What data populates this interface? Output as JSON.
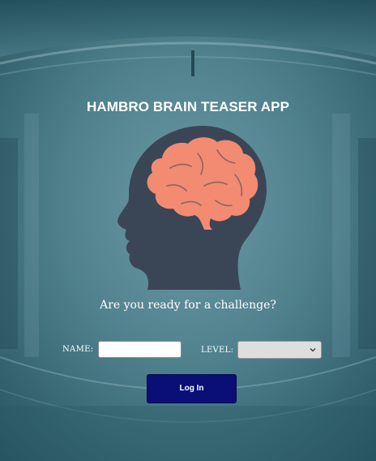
{
  "app": {
    "title": "HAMBRO BRAIN TEASER APP",
    "tagline": "Are you ready for a challenge?"
  },
  "form": {
    "name_label": "NAME:",
    "name_value": "",
    "level_label": "LEVEL:",
    "level_selected": "",
    "login_label": "Log In"
  },
  "icons": {
    "logo": "head-with-brain-icon",
    "select_arrow": "chevron-down-icon"
  },
  "colors": {
    "background": "#3d6f7c",
    "head": "#3a4656",
    "brain": "#f28b72",
    "login_button": "#0a0f78"
  }
}
